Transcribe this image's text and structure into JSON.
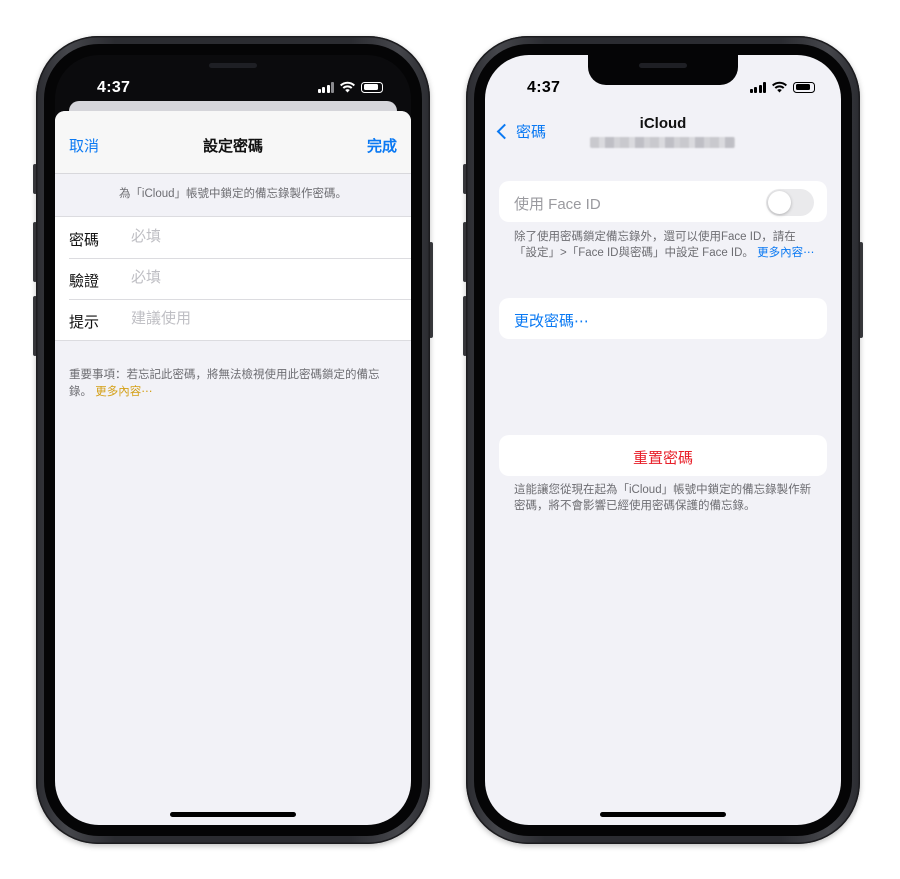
{
  "left_phone": {
    "status": {
      "time": "4:37"
    },
    "nav": {
      "cancel": "取消",
      "title": "設定密碼",
      "done": "完成"
    },
    "description": "為「iCloud」帳號中鎖定的備忘錄製作密碼。",
    "form": {
      "rows": [
        {
          "label": "密碼",
          "placeholder": "必填"
        },
        {
          "label": "驗證",
          "placeholder": "必填"
        },
        {
          "label": "提示",
          "placeholder": "建議使用"
        }
      ]
    },
    "note": {
      "text": "重要事項：若忘記此密碼，將無法檢視使用此密碼鎖定的備忘錄。",
      "link": "更多內容⋯"
    }
  },
  "right_phone": {
    "status": {
      "time": "4:37"
    },
    "nav": {
      "back": "密碼",
      "title": "iCloud"
    },
    "face_id": {
      "label": "使用 Face ID",
      "enabled": false,
      "note": "除了使用密碼鎖定備忘錄外，還可以使用Face ID，請在「設定」>「Face ID與密碼」中設定 Face ID。",
      "link": "更多內容⋯"
    },
    "change_password": "更改密碼⋯",
    "reset_password": "重置密碼",
    "reset_note": "這能讓您從現在起為「iCloud」帳號中鎖定的備忘錄製作新密碼，將不會影響已經使用密碼保護的備忘錄。"
  },
  "colors": {
    "accent_blue": "#0a79f3",
    "destructive_red": "#e8202a",
    "link_yellow": "#d4a017",
    "grouped_background": "#f2f2f7"
  },
  "icons": [
    "signal-icon",
    "wifi-icon",
    "battery-icon",
    "back-chevron-icon"
  ]
}
